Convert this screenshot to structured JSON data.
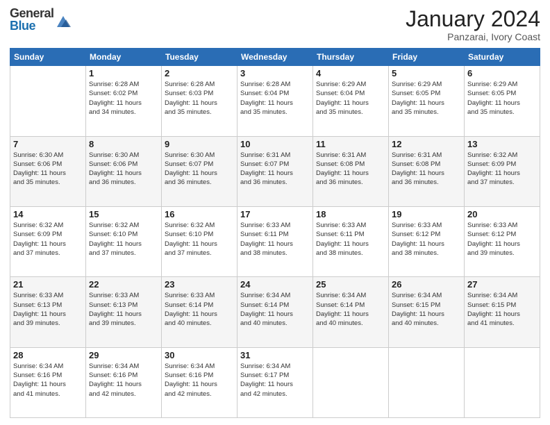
{
  "header": {
    "logo_general": "General",
    "logo_blue": "Blue",
    "month_title": "January 2024",
    "subtitle": "Panzarai, Ivory Coast"
  },
  "days_of_week": [
    "Sunday",
    "Monday",
    "Tuesday",
    "Wednesday",
    "Thursday",
    "Friday",
    "Saturday"
  ],
  "weeks": [
    [
      {
        "day": "",
        "sunrise": "",
        "sunset": "",
        "daylight": ""
      },
      {
        "day": "1",
        "sunrise": "Sunrise: 6:28 AM",
        "sunset": "Sunset: 6:02 PM",
        "daylight": "Daylight: 11 hours and 34 minutes."
      },
      {
        "day": "2",
        "sunrise": "Sunrise: 6:28 AM",
        "sunset": "Sunset: 6:03 PM",
        "daylight": "Daylight: 11 hours and 35 minutes."
      },
      {
        "day": "3",
        "sunrise": "Sunrise: 6:28 AM",
        "sunset": "Sunset: 6:04 PM",
        "daylight": "Daylight: 11 hours and 35 minutes."
      },
      {
        "day": "4",
        "sunrise": "Sunrise: 6:29 AM",
        "sunset": "Sunset: 6:04 PM",
        "daylight": "Daylight: 11 hours and 35 minutes."
      },
      {
        "day": "5",
        "sunrise": "Sunrise: 6:29 AM",
        "sunset": "Sunset: 6:05 PM",
        "daylight": "Daylight: 11 hours and 35 minutes."
      },
      {
        "day": "6",
        "sunrise": "Sunrise: 6:29 AM",
        "sunset": "Sunset: 6:05 PM",
        "daylight": "Daylight: 11 hours and 35 minutes."
      }
    ],
    [
      {
        "day": "7",
        "sunrise": "Sunrise: 6:30 AM",
        "sunset": "Sunset: 6:06 PM",
        "daylight": "Daylight: 11 hours and 35 minutes."
      },
      {
        "day": "8",
        "sunrise": "Sunrise: 6:30 AM",
        "sunset": "Sunset: 6:06 PM",
        "daylight": "Daylight: 11 hours and 36 minutes."
      },
      {
        "day": "9",
        "sunrise": "Sunrise: 6:30 AM",
        "sunset": "Sunset: 6:07 PM",
        "daylight": "Daylight: 11 hours and 36 minutes."
      },
      {
        "day": "10",
        "sunrise": "Sunrise: 6:31 AM",
        "sunset": "Sunset: 6:07 PM",
        "daylight": "Daylight: 11 hours and 36 minutes."
      },
      {
        "day": "11",
        "sunrise": "Sunrise: 6:31 AM",
        "sunset": "Sunset: 6:08 PM",
        "daylight": "Daylight: 11 hours and 36 minutes."
      },
      {
        "day": "12",
        "sunrise": "Sunrise: 6:31 AM",
        "sunset": "Sunset: 6:08 PM",
        "daylight": "Daylight: 11 hours and 36 minutes."
      },
      {
        "day": "13",
        "sunrise": "Sunrise: 6:32 AM",
        "sunset": "Sunset: 6:09 PM",
        "daylight": "Daylight: 11 hours and 37 minutes."
      }
    ],
    [
      {
        "day": "14",
        "sunrise": "Sunrise: 6:32 AM",
        "sunset": "Sunset: 6:09 PM",
        "daylight": "Daylight: 11 hours and 37 minutes."
      },
      {
        "day": "15",
        "sunrise": "Sunrise: 6:32 AM",
        "sunset": "Sunset: 6:10 PM",
        "daylight": "Daylight: 11 hours and 37 minutes."
      },
      {
        "day": "16",
        "sunrise": "Sunrise: 6:32 AM",
        "sunset": "Sunset: 6:10 PM",
        "daylight": "Daylight: 11 hours and 37 minutes."
      },
      {
        "day": "17",
        "sunrise": "Sunrise: 6:33 AM",
        "sunset": "Sunset: 6:11 PM",
        "daylight": "Daylight: 11 hours and 38 minutes."
      },
      {
        "day": "18",
        "sunrise": "Sunrise: 6:33 AM",
        "sunset": "Sunset: 6:11 PM",
        "daylight": "Daylight: 11 hours and 38 minutes."
      },
      {
        "day": "19",
        "sunrise": "Sunrise: 6:33 AM",
        "sunset": "Sunset: 6:12 PM",
        "daylight": "Daylight: 11 hours and 38 minutes."
      },
      {
        "day": "20",
        "sunrise": "Sunrise: 6:33 AM",
        "sunset": "Sunset: 6:12 PM",
        "daylight": "Daylight: 11 hours and 39 minutes."
      }
    ],
    [
      {
        "day": "21",
        "sunrise": "Sunrise: 6:33 AM",
        "sunset": "Sunset: 6:13 PM",
        "daylight": "Daylight: 11 hours and 39 minutes."
      },
      {
        "day": "22",
        "sunrise": "Sunrise: 6:33 AM",
        "sunset": "Sunset: 6:13 PM",
        "daylight": "Daylight: 11 hours and 39 minutes."
      },
      {
        "day": "23",
        "sunrise": "Sunrise: 6:33 AM",
        "sunset": "Sunset: 6:14 PM",
        "daylight": "Daylight: 11 hours and 40 minutes."
      },
      {
        "day": "24",
        "sunrise": "Sunrise: 6:34 AM",
        "sunset": "Sunset: 6:14 PM",
        "daylight": "Daylight: 11 hours and 40 minutes."
      },
      {
        "day": "25",
        "sunrise": "Sunrise: 6:34 AM",
        "sunset": "Sunset: 6:14 PM",
        "daylight": "Daylight: 11 hours and 40 minutes."
      },
      {
        "day": "26",
        "sunrise": "Sunrise: 6:34 AM",
        "sunset": "Sunset: 6:15 PM",
        "daylight": "Daylight: 11 hours and 40 minutes."
      },
      {
        "day": "27",
        "sunrise": "Sunrise: 6:34 AM",
        "sunset": "Sunset: 6:15 PM",
        "daylight": "Daylight: 11 hours and 41 minutes."
      }
    ],
    [
      {
        "day": "28",
        "sunrise": "Sunrise: 6:34 AM",
        "sunset": "Sunset: 6:16 PM",
        "daylight": "Daylight: 11 hours and 41 minutes."
      },
      {
        "day": "29",
        "sunrise": "Sunrise: 6:34 AM",
        "sunset": "Sunset: 6:16 PM",
        "daylight": "Daylight: 11 hours and 42 minutes."
      },
      {
        "day": "30",
        "sunrise": "Sunrise: 6:34 AM",
        "sunset": "Sunset: 6:16 PM",
        "daylight": "Daylight: 11 hours and 42 minutes."
      },
      {
        "day": "31",
        "sunrise": "Sunrise: 6:34 AM",
        "sunset": "Sunset: 6:17 PM",
        "daylight": "Daylight: 11 hours and 42 minutes."
      },
      {
        "day": "",
        "sunrise": "",
        "sunset": "",
        "daylight": ""
      },
      {
        "day": "",
        "sunrise": "",
        "sunset": "",
        "daylight": ""
      },
      {
        "day": "",
        "sunrise": "",
        "sunset": "",
        "daylight": ""
      }
    ]
  ]
}
